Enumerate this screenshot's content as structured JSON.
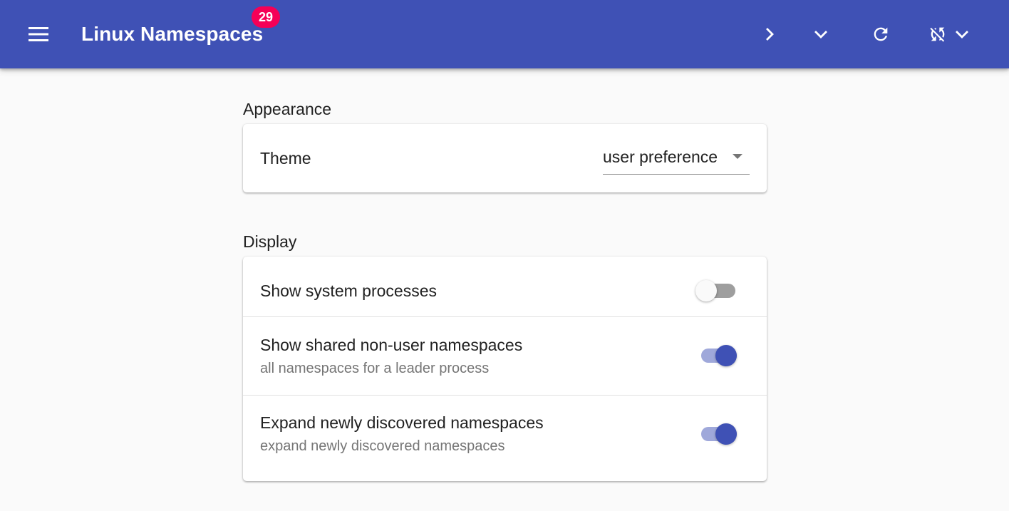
{
  "appbar": {
    "title": "Linux Namespaces",
    "badge": "29",
    "background": "#3f51b5",
    "badge_color": "#f50057",
    "icons": [
      "menu-icon",
      "chevron-right-icon",
      "chevron-down-icon",
      "refresh-icon",
      "sync-disabled-icon",
      "chevron-down-icon"
    ]
  },
  "sections": {
    "appearance": {
      "label": "Appearance",
      "theme": {
        "label": "Theme",
        "value": "user preference"
      }
    },
    "display": {
      "label": "Display",
      "items": [
        {
          "label": "Show system processes",
          "secondary": "",
          "checked": false
        },
        {
          "label": "Show shared non-user namespaces",
          "secondary": "all namespaces for a leader process",
          "checked": true
        },
        {
          "label": "Expand newly discovered namespaces",
          "secondary": "expand newly discovered namespaces",
          "checked": true
        }
      ]
    }
  }
}
